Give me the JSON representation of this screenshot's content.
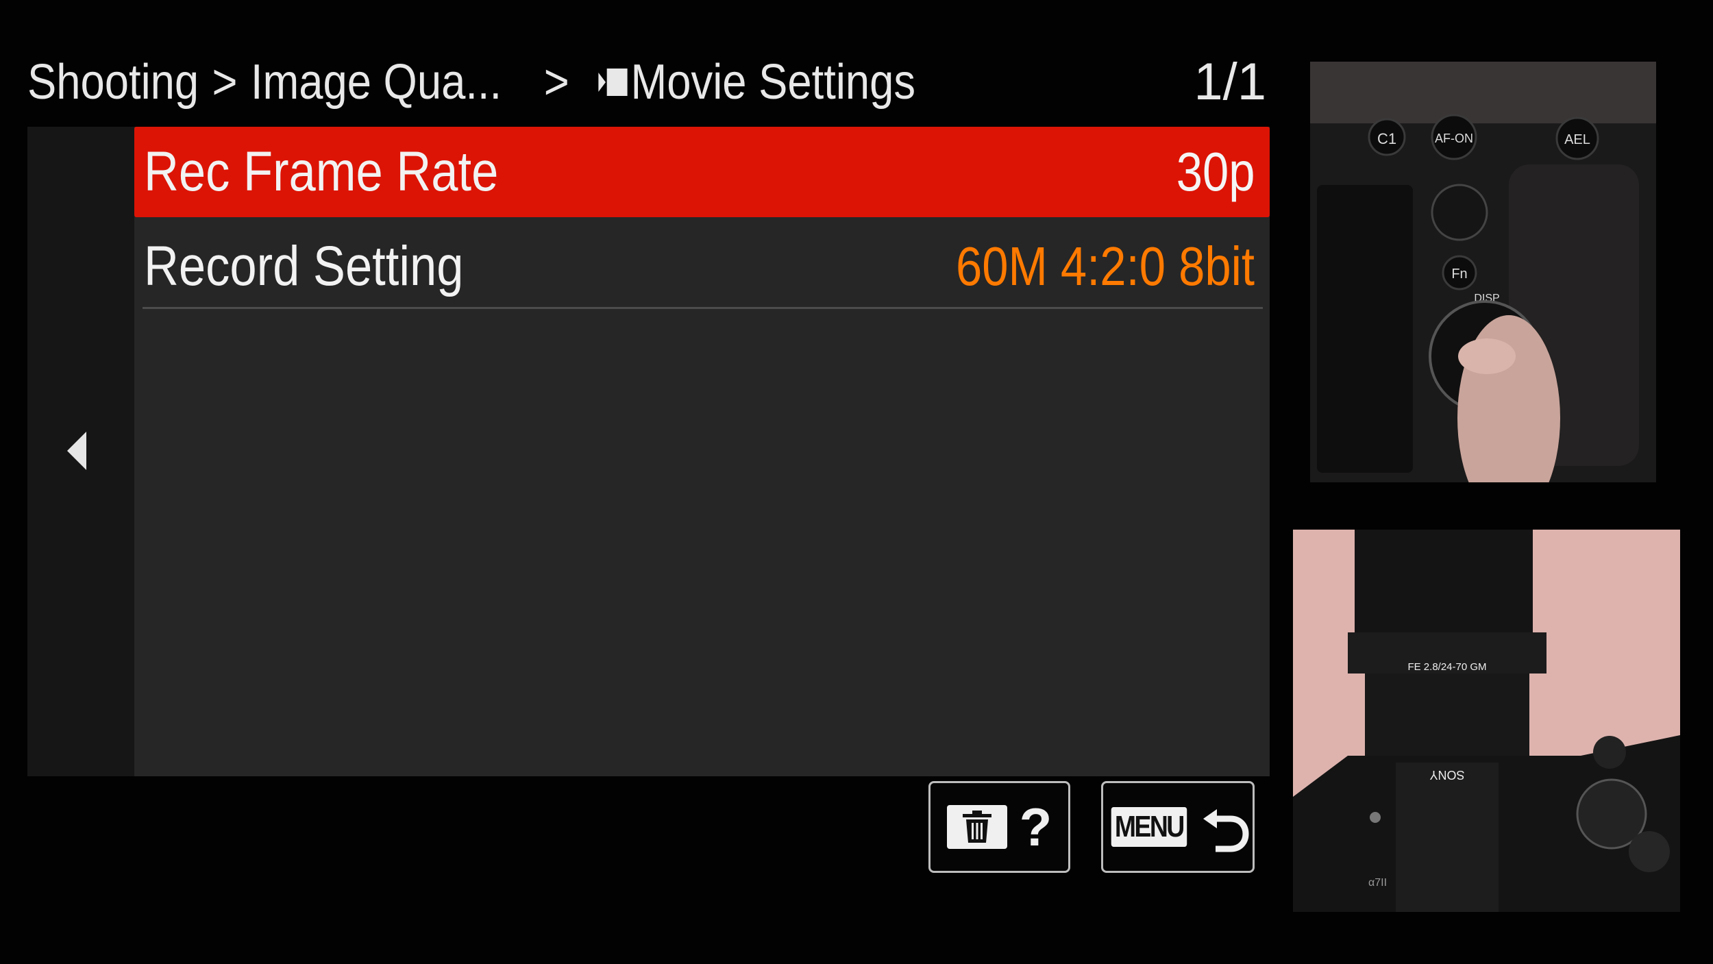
{
  "breadcrumb": {
    "level1": "Shooting",
    "level2": "Image Qua...",
    "level3": "Movie Settings",
    "separator": ">"
  },
  "page_indicator": "1/1",
  "menu": {
    "items": [
      {
        "label": "Rec Frame Rate",
        "value": "30p",
        "selected": true
      },
      {
        "label": "Record Setting",
        "value": "60M 4:2:0 8bit",
        "selected": false
      }
    ]
  },
  "buttons": {
    "delete_help_icon": "trash-icon",
    "help_label": "?",
    "menu_label": "MENU",
    "back_icon": "return-arrow-icon"
  },
  "photos": {
    "top_camera_buttons": [
      "C1",
      "AF-ON",
      "AEL",
      "Fn",
      "DISP"
    ],
    "bottom_lens_text": "FE 2.8/24-70 GM",
    "bottom_brand": "SONY",
    "bottom_model": "α7II"
  },
  "colors": {
    "selected_row": "#dc1405",
    "value_accent": "#ff7a00",
    "panel_bg": "#262626",
    "side_bg": "#161616"
  }
}
